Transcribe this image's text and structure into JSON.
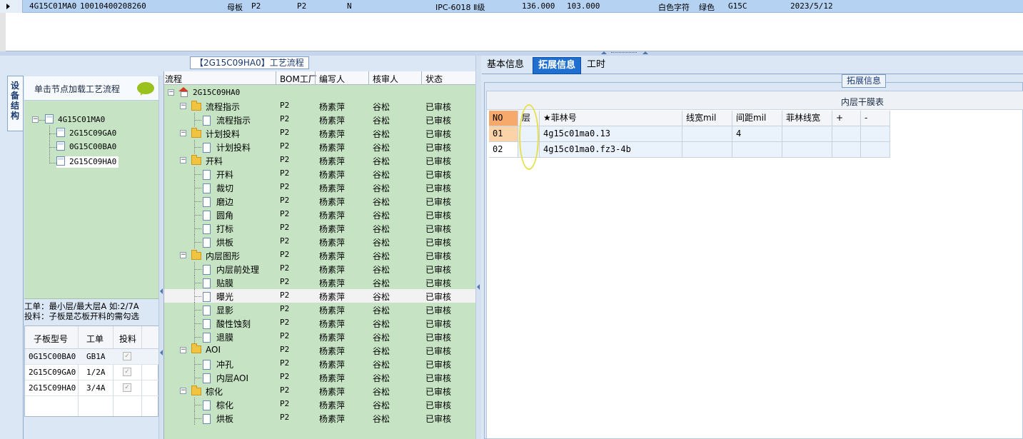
{
  "top_row": {
    "cells": [
      "4G15C01MA0",
      "10010400208260",
      "母板",
      "P2",
      "P2",
      "N",
      "IPC-6018 Ⅱ级",
      "136.000",
      "103.000",
      "白色字符",
      "绿色",
      "G15C",
      "2023/5/12"
    ]
  },
  "left": {
    "panel_title": "【2G15C09HA0】工艺流程",
    "side_tab_label": "设备结构",
    "struct_header": "单击节点加载工艺流程",
    "struct_tree": {
      "root": "4G15C01MA0",
      "children": [
        "2G15C09GA0",
        "0G15C00BA0",
        "2G15C09HA0"
      ]
    },
    "info_line1": "工单：最小层/最大层A 如:2/7A",
    "info_line2": "投料：子板是芯板开料的需勾选",
    "sub_table": {
      "headers": [
        "子板型号",
        "工单",
        "投料"
      ],
      "rows": [
        {
          "model": "0G15C00BA0",
          "order": "GB1A",
          "feed": "✓"
        },
        {
          "model": "2G15C09GA0",
          "order": "1/2A",
          "feed": "✓"
        },
        {
          "model": "2G15C09HA0",
          "order": "3/4A",
          "feed": "✓"
        }
      ]
    }
  },
  "process": {
    "headers": [
      "流程",
      "BOM工厂",
      "编写人",
      "核审人",
      "状态"
    ],
    "root": "2G15C09HA0",
    "rows": [
      {
        "name": "流程指示",
        "bom": "P2",
        "writer": "杨素萍",
        "reviewer": "谷松",
        "status": "已审核"
      },
      {
        "name": "流程指示",
        "bom": "P2",
        "writer": "杨素萍",
        "reviewer": "谷松",
        "status": "已审核"
      },
      {
        "name": "计划投料",
        "bom": "P2",
        "writer": "杨素萍",
        "reviewer": "谷松",
        "status": "已审核"
      },
      {
        "name": "计划投料",
        "bom": "P2",
        "writer": "杨素萍",
        "reviewer": "谷松",
        "status": "已审核"
      },
      {
        "name": "开料",
        "bom": "P2",
        "writer": "杨素萍",
        "reviewer": "谷松",
        "status": "已审核"
      },
      {
        "name": "开料",
        "bom": "P2",
        "writer": "杨素萍",
        "reviewer": "谷松",
        "status": "已审核"
      },
      {
        "name": "裁切",
        "bom": "P2",
        "writer": "杨素萍",
        "reviewer": "谷松",
        "status": "已审核"
      },
      {
        "name": "磨边",
        "bom": "P2",
        "writer": "杨素萍",
        "reviewer": "谷松",
        "status": "已审核"
      },
      {
        "name": "圆角",
        "bom": "P2",
        "writer": "杨素萍",
        "reviewer": "谷松",
        "status": "已审核"
      },
      {
        "name": "打标",
        "bom": "P2",
        "writer": "杨素萍",
        "reviewer": "谷松",
        "status": "已审核"
      },
      {
        "name": "烘板",
        "bom": "P2",
        "writer": "杨素萍",
        "reviewer": "谷松",
        "status": "已审核"
      },
      {
        "name": "内层图形",
        "bom": "P2",
        "writer": "杨素萍",
        "reviewer": "谷松",
        "status": "已审核"
      },
      {
        "name": "内层前处理",
        "bom": "P2",
        "writer": "杨素萍",
        "reviewer": "谷松",
        "status": "已审核"
      },
      {
        "name": "贴膜",
        "bom": "P2",
        "writer": "杨素萍",
        "reviewer": "谷松",
        "status": "已审核"
      },
      {
        "name": "曝光",
        "bom": "P2",
        "writer": "杨素萍",
        "reviewer": "谷松",
        "status": "已审核"
      },
      {
        "name": "显影",
        "bom": "P2",
        "writer": "杨素萍",
        "reviewer": "谷松",
        "status": "已审核"
      },
      {
        "name": "酸性蚀刻",
        "bom": "P2",
        "writer": "杨素萍",
        "reviewer": "谷松",
        "status": "已审核"
      },
      {
        "name": "退膜",
        "bom": "P2",
        "writer": "杨素萍",
        "reviewer": "谷松",
        "status": "已审核"
      },
      {
        "name": "AOI",
        "bom": "P2",
        "writer": "杨素萍",
        "reviewer": "谷松",
        "status": "已审核"
      },
      {
        "name": "冲孔",
        "bom": "P2",
        "writer": "杨素萍",
        "reviewer": "谷松",
        "status": "已审核"
      },
      {
        "name": "内层AOI",
        "bom": "P2",
        "writer": "杨素萍",
        "reviewer": "谷松",
        "status": "已审核"
      },
      {
        "name": "棕化",
        "bom": "P2",
        "writer": "杨素萍",
        "reviewer": "谷松",
        "status": "已审核"
      },
      {
        "name": "棕化",
        "bom": "P2",
        "writer": "杨素萍",
        "reviewer": "谷松",
        "status": "已审核"
      },
      {
        "name": "烘板",
        "bom": "P2",
        "writer": "杨素萍",
        "reviewer": "谷松",
        "status": "已审核"
      }
    ]
  },
  "right": {
    "tabs": [
      "基本信息",
      "拓展信息",
      "工时"
    ],
    "active_tab": "拓展信息",
    "group_title": "拓展信息",
    "film_table_title": "内层干膜表",
    "film_headers": [
      "NO",
      "层",
      "★菲林号",
      "线宽mil",
      "间距mil",
      "菲林线宽",
      "+",
      "-"
    ],
    "film_rows": [
      {
        "no": "01",
        "layer": "",
        "film": "4g15c01ma0.13",
        "width": "",
        "spacing": "4",
        "film_width": "",
        "plus": "",
        "minus": ""
      },
      {
        "no": "02",
        "layer": "",
        "film": "4g15c01ma0.fz3-4b",
        "width": "",
        "spacing": "",
        "film_width": "",
        "plus": "",
        "minus": ""
      }
    ]
  }
}
